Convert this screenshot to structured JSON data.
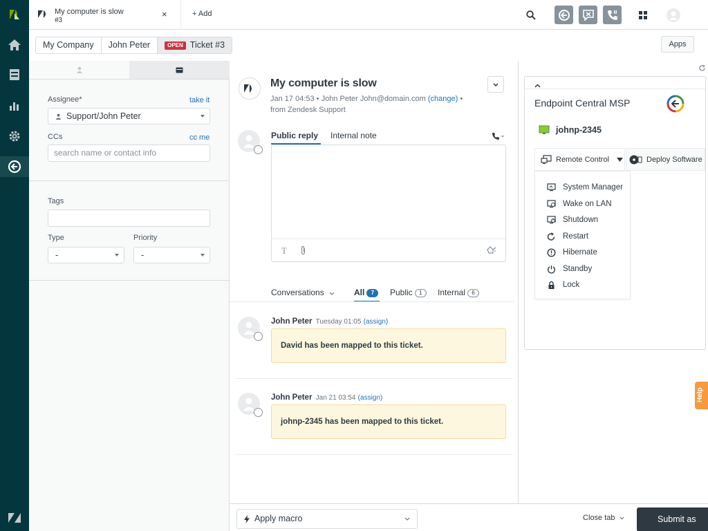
{
  "tab": {
    "title": "My computer is slow",
    "subtitle": "#3",
    "close": "×"
  },
  "topbar": {
    "add_label": "+ Add"
  },
  "breadcrumbs": {
    "org": "My Company",
    "user": "John Peter",
    "status": "OPEN",
    "ticket": "Ticket #3"
  },
  "apps_label": "Apps",
  "properties": {
    "assignee_label": "Assignee*",
    "take_it": "take it",
    "assignee_value": "Support/John Peter",
    "ccs_label": "CCs",
    "cc_me": "cc me",
    "ccs_placeholder": "search name or contact info",
    "tags_label": "Tags",
    "type_label": "Type",
    "type_value": "-",
    "priority_label": "Priority",
    "priority_value": "-"
  },
  "ticket": {
    "title": "My computer is slow",
    "meta_date": "Jan 17 04:53",
    "meta_from": "John Peter John@domain.com",
    "meta_change": "(change)",
    "meta_source": "from Zendesk Support",
    "public_reply": "Public reply",
    "internal_note": "Internal note"
  },
  "conversation_filters": {
    "conversations": "Conversations",
    "all": "All",
    "all_count": "7",
    "public": "Public",
    "public_count": "1",
    "internal": "Internal",
    "internal_count": "6"
  },
  "events": [
    {
      "author": "John Peter",
      "time": "Tuesday 01:05",
      "assign": "(assign)",
      "note": "David has been mapped to this ticket."
    },
    {
      "author": "John Peter",
      "time": "Jan 21 03:54",
      "assign": "(assign)",
      "note": "johnp-2345 has been mapped to this ticket."
    }
  ],
  "app": {
    "title": "Endpoint Central MSP",
    "device": "johnp-2345",
    "remote_control": "Remote Control",
    "deploy_software": "Deploy Software",
    "menu": [
      "System Manager",
      "Wake on LAN",
      "Shutdown",
      "Restart",
      "Hibernate",
      "Standby",
      "Lock"
    ]
  },
  "bottom": {
    "apply_macro": "Apply macro",
    "close_tab": "Close tab",
    "submit": "Submit as"
  },
  "help_label": "Help",
  "colors": {
    "nav": "#03363d",
    "accent": "#1f73b7",
    "badge": "#cc3340",
    "note_bg": "#fef7e0"
  }
}
